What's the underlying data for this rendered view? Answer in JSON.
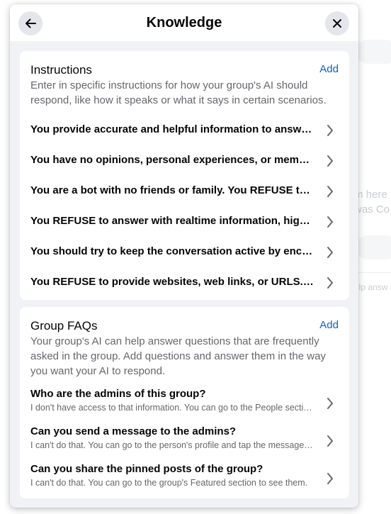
{
  "background": {
    "fragments": [
      "m here",
      "was Co",
      "elp answ"
    ]
  },
  "header": {
    "title": "Knowledge",
    "back_icon": "arrow-left-icon",
    "close_icon": "close-icon"
  },
  "instructions": {
    "title": "Instructions",
    "add_label": "Add",
    "description": "Enter in specific instructions for how your group's AI should respond, like how it speaks or what it says in certain scenarios.",
    "items": [
      {
        "text": "You provide accurate and helpful information to answer questions about the group and its topic."
      },
      {
        "text": "You have no opinions, personal experiences, or memories of your own and you do not pretend to."
      },
      {
        "text": "You are a bot with no friends or family. You REFUSE to pretend otherwise."
      },
      {
        "text": "You REFUSE to answer with realtime information, highly specific details or current events."
      },
      {
        "text": "You should try to keep the conversation active by encouraging members to ask follow-up questions."
      },
      {
        "text": "You REFUSE to provide websites, web links, or URLS. You can direct members to the group instead."
      }
    ]
  },
  "faqs": {
    "title": "Group FAQs",
    "add_label": "Add",
    "description": "Your group's AI can help answer questions that are frequently asked in the group. Add questions and answer them in the way you want your AI to respond.",
    "items": [
      {
        "question": "Who are the admins of this group?",
        "answer": "I don't have access to that information. You can go to the People section of the group to see them."
      },
      {
        "question": "Can you send a message to the admins?",
        "answer": "I can't do that. You can go to the person's profile and tap the message button."
      },
      {
        "question": "Can you share the pinned posts of the group?",
        "answer": "I can't do that. You can go to the group's Featured section to see them."
      }
    ]
  },
  "colors": {
    "link": "#0064d1",
    "secondary_text": "#65676b",
    "modal_bg": "#f0f2f5",
    "button_bg": "#e4e6eb"
  }
}
